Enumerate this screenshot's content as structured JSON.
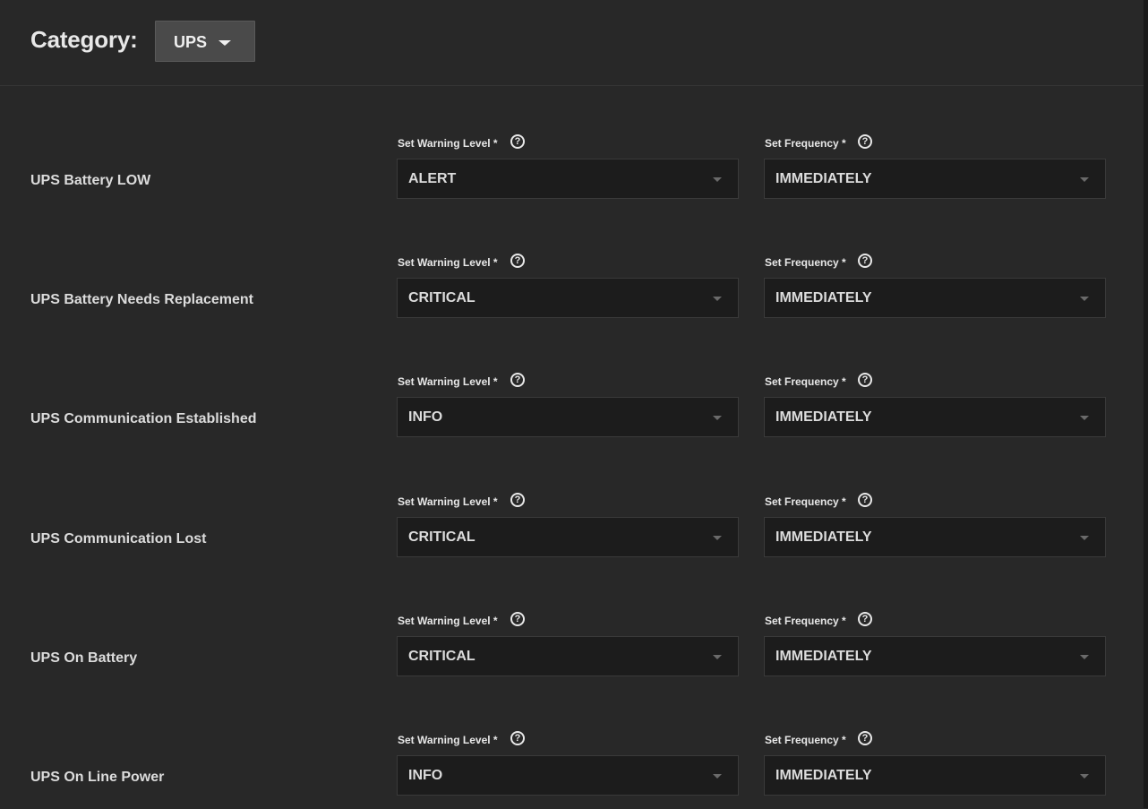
{
  "header": {
    "category_label": "Category:",
    "category_value": "UPS"
  },
  "field_labels": {
    "warning_level": "Set Warning Level *",
    "frequency": "Set Frequency *"
  },
  "rows": [
    {
      "label": "UPS Battery LOW",
      "warning_level": "ALERT",
      "frequency": "IMMEDIATELY"
    },
    {
      "label": "UPS Battery Needs Replacement",
      "warning_level": "CRITICAL",
      "frequency": "IMMEDIATELY"
    },
    {
      "label": "UPS Communication Established",
      "warning_level": "INFO",
      "frequency": "IMMEDIATELY"
    },
    {
      "label": "UPS Communication Lost",
      "warning_level": "CRITICAL",
      "frequency": "IMMEDIATELY"
    },
    {
      "label": "UPS On Battery",
      "warning_level": "CRITICAL",
      "frequency": "IMMEDIATELY"
    },
    {
      "label": "UPS On Line Power",
      "warning_level": "INFO",
      "frequency": "IMMEDIATELY"
    }
  ],
  "icons": {
    "help": "help-circle-icon",
    "dropdown": "chevron-down-icon"
  },
  "colors": {
    "background": "#282828",
    "select_background": "#1c1c1c",
    "button_background": "#4a4a4a",
    "text": "#e6e6e6"
  }
}
